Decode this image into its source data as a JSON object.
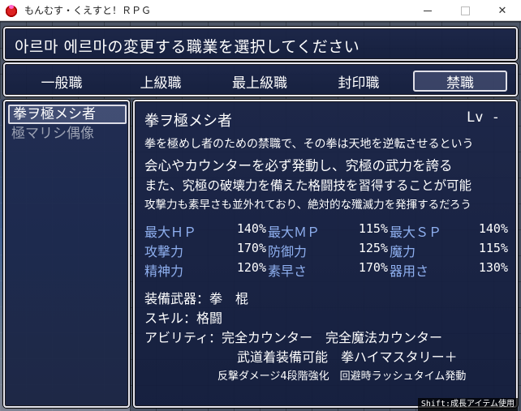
{
  "window": {
    "title": "もんむす・くえすと！ＲＰＧ"
  },
  "help": {
    "text": "아르마 에르마の変更する職業を選択してください"
  },
  "categories": [
    {
      "label": "一般職"
    },
    {
      "label": "上級職"
    },
    {
      "label": "最上級職"
    },
    {
      "label": "封印職"
    },
    {
      "label": "禁職",
      "selected": true
    }
  ],
  "job_list": [
    {
      "label": "拳ヲ極メシ者",
      "selected": true
    },
    {
      "label": "極マリシ偶像",
      "selected": false
    }
  ],
  "detail": {
    "name": "拳ヲ極メシ者",
    "level": "Lv  -",
    "desc": [
      "拳を極めし者のための禁職で、その拳は天地を逆転させるという",
      "会心やカウンターを必ず発動し、究極の武力を誇る",
      "また、究極の破壊力を備えた格闘技を習得することが可能",
      "攻撃力も素早さも並外れており、絶対的な殲滅力を発揮するだろう"
    ],
    "stats": [
      [
        {
          "label": "最大ＨＰ",
          "value": "140%"
        },
        {
          "label": "最大ＭＰ",
          "value": "115%"
        },
        {
          "label": "最大ＳＰ",
          "value": "140%"
        }
      ],
      [
        {
          "label": "攻撃力",
          "value": "170%"
        },
        {
          "label": "防御力",
          "value": "125%"
        },
        {
          "label": "魔力",
          "value": "115%"
        }
      ],
      [
        {
          "label": "精神力",
          "value": "120%"
        },
        {
          "label": "素早さ",
          "value": "170%"
        },
        {
          "label": "器用さ",
          "value": "130%"
        }
      ]
    ],
    "equipment": "装備武器：拳　棍",
    "skill": "スキル：格闘",
    "ability_line1": "アビリティ：完全カウンター　完全魔法カウンター",
    "ability_line2": "武道着装備可能　拳ハイマスタリー＋",
    "ability_line3": "反撃ダメージ4段階強化　回避時ラッシュタイム発動"
  },
  "hint": "Shift:成長アイテム使用",
  "colors": {
    "window_bg": "#1c2a52",
    "stat_label": "#8fb0f0",
    "border": "#e8e8f0"
  }
}
